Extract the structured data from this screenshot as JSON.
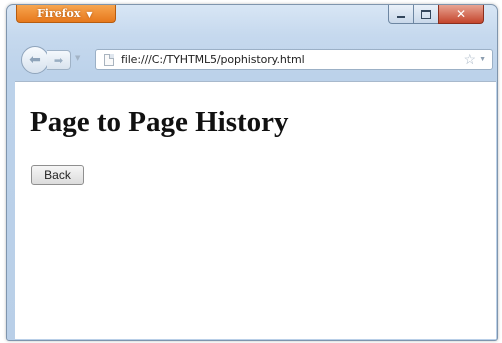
{
  "browser": {
    "app_menu_label": "Firefox",
    "address": "file:///C:/TYHTML5/pophistory.html"
  },
  "page": {
    "title": "Page to Page History",
    "back_button_label": "Back"
  },
  "colors": {
    "firefox_orange": "#e7781c",
    "chrome_blue": "#c6d9ee",
    "close_red": "#c4452c"
  }
}
